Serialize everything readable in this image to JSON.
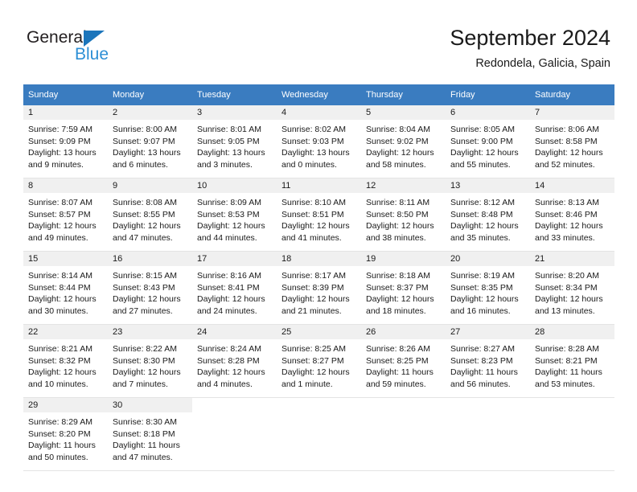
{
  "brand": {
    "name_part1": "General",
    "name_part2": "Blue",
    "logo_icon": "triangle-logo-icon",
    "primary_color": "#1b75bb",
    "secondary_color": "#2d8fd5"
  },
  "header": {
    "title": "September 2024",
    "location": "Redondela, Galicia, Spain"
  },
  "calendar": {
    "header_bg": "#3a7cc0",
    "daynum_bg": "#f0f0f0",
    "weekday_headers": [
      "Sunday",
      "Monday",
      "Tuesday",
      "Wednesday",
      "Thursday",
      "Friday",
      "Saturday"
    ],
    "weeks": [
      [
        {
          "day": "1",
          "sunrise": "Sunrise: 7:59 AM",
          "sunset": "Sunset: 9:09 PM",
          "daylight_line1": "Daylight: 13 hours",
          "daylight_line2": "and 9 minutes."
        },
        {
          "day": "2",
          "sunrise": "Sunrise: 8:00 AM",
          "sunset": "Sunset: 9:07 PM",
          "daylight_line1": "Daylight: 13 hours",
          "daylight_line2": "and 6 minutes."
        },
        {
          "day": "3",
          "sunrise": "Sunrise: 8:01 AM",
          "sunset": "Sunset: 9:05 PM",
          "daylight_line1": "Daylight: 13 hours",
          "daylight_line2": "and 3 minutes."
        },
        {
          "day": "4",
          "sunrise": "Sunrise: 8:02 AM",
          "sunset": "Sunset: 9:03 PM",
          "daylight_line1": "Daylight: 13 hours",
          "daylight_line2": "and 0 minutes."
        },
        {
          "day": "5",
          "sunrise": "Sunrise: 8:04 AM",
          "sunset": "Sunset: 9:02 PM",
          "daylight_line1": "Daylight: 12 hours",
          "daylight_line2": "and 58 minutes."
        },
        {
          "day": "6",
          "sunrise": "Sunrise: 8:05 AM",
          "sunset": "Sunset: 9:00 PM",
          "daylight_line1": "Daylight: 12 hours",
          "daylight_line2": "and 55 minutes."
        },
        {
          "day": "7",
          "sunrise": "Sunrise: 8:06 AM",
          "sunset": "Sunset: 8:58 PM",
          "daylight_line1": "Daylight: 12 hours",
          "daylight_line2": "and 52 minutes."
        }
      ],
      [
        {
          "day": "8",
          "sunrise": "Sunrise: 8:07 AM",
          "sunset": "Sunset: 8:57 PM",
          "daylight_line1": "Daylight: 12 hours",
          "daylight_line2": "and 49 minutes."
        },
        {
          "day": "9",
          "sunrise": "Sunrise: 8:08 AM",
          "sunset": "Sunset: 8:55 PM",
          "daylight_line1": "Daylight: 12 hours",
          "daylight_line2": "and 47 minutes."
        },
        {
          "day": "10",
          "sunrise": "Sunrise: 8:09 AM",
          "sunset": "Sunset: 8:53 PM",
          "daylight_line1": "Daylight: 12 hours",
          "daylight_line2": "and 44 minutes."
        },
        {
          "day": "11",
          "sunrise": "Sunrise: 8:10 AM",
          "sunset": "Sunset: 8:51 PM",
          "daylight_line1": "Daylight: 12 hours",
          "daylight_line2": "and 41 minutes."
        },
        {
          "day": "12",
          "sunrise": "Sunrise: 8:11 AM",
          "sunset": "Sunset: 8:50 PM",
          "daylight_line1": "Daylight: 12 hours",
          "daylight_line2": "and 38 minutes."
        },
        {
          "day": "13",
          "sunrise": "Sunrise: 8:12 AM",
          "sunset": "Sunset: 8:48 PM",
          "daylight_line1": "Daylight: 12 hours",
          "daylight_line2": "and 35 minutes."
        },
        {
          "day": "14",
          "sunrise": "Sunrise: 8:13 AM",
          "sunset": "Sunset: 8:46 PM",
          "daylight_line1": "Daylight: 12 hours",
          "daylight_line2": "and 33 minutes."
        }
      ],
      [
        {
          "day": "15",
          "sunrise": "Sunrise: 8:14 AM",
          "sunset": "Sunset: 8:44 PM",
          "daylight_line1": "Daylight: 12 hours",
          "daylight_line2": "and 30 minutes."
        },
        {
          "day": "16",
          "sunrise": "Sunrise: 8:15 AM",
          "sunset": "Sunset: 8:43 PM",
          "daylight_line1": "Daylight: 12 hours",
          "daylight_line2": "and 27 minutes."
        },
        {
          "day": "17",
          "sunrise": "Sunrise: 8:16 AM",
          "sunset": "Sunset: 8:41 PM",
          "daylight_line1": "Daylight: 12 hours",
          "daylight_line2": "and 24 minutes."
        },
        {
          "day": "18",
          "sunrise": "Sunrise: 8:17 AM",
          "sunset": "Sunset: 8:39 PM",
          "daylight_line1": "Daylight: 12 hours",
          "daylight_line2": "and 21 minutes."
        },
        {
          "day": "19",
          "sunrise": "Sunrise: 8:18 AM",
          "sunset": "Sunset: 8:37 PM",
          "daylight_line1": "Daylight: 12 hours",
          "daylight_line2": "and 18 minutes."
        },
        {
          "day": "20",
          "sunrise": "Sunrise: 8:19 AM",
          "sunset": "Sunset: 8:35 PM",
          "daylight_line1": "Daylight: 12 hours",
          "daylight_line2": "and 16 minutes."
        },
        {
          "day": "21",
          "sunrise": "Sunrise: 8:20 AM",
          "sunset": "Sunset: 8:34 PM",
          "daylight_line1": "Daylight: 12 hours",
          "daylight_line2": "and 13 minutes."
        }
      ],
      [
        {
          "day": "22",
          "sunrise": "Sunrise: 8:21 AM",
          "sunset": "Sunset: 8:32 PM",
          "daylight_line1": "Daylight: 12 hours",
          "daylight_line2": "and 10 minutes."
        },
        {
          "day": "23",
          "sunrise": "Sunrise: 8:22 AM",
          "sunset": "Sunset: 8:30 PM",
          "daylight_line1": "Daylight: 12 hours",
          "daylight_line2": "and 7 minutes."
        },
        {
          "day": "24",
          "sunrise": "Sunrise: 8:24 AM",
          "sunset": "Sunset: 8:28 PM",
          "daylight_line1": "Daylight: 12 hours",
          "daylight_line2": "and 4 minutes."
        },
        {
          "day": "25",
          "sunrise": "Sunrise: 8:25 AM",
          "sunset": "Sunset: 8:27 PM",
          "daylight_line1": "Daylight: 12 hours",
          "daylight_line2": "and 1 minute."
        },
        {
          "day": "26",
          "sunrise": "Sunrise: 8:26 AM",
          "sunset": "Sunset: 8:25 PM",
          "daylight_line1": "Daylight: 11 hours",
          "daylight_line2": "and 59 minutes."
        },
        {
          "day": "27",
          "sunrise": "Sunrise: 8:27 AM",
          "sunset": "Sunset: 8:23 PM",
          "daylight_line1": "Daylight: 11 hours",
          "daylight_line2": "and 56 minutes."
        },
        {
          "day": "28",
          "sunrise": "Sunrise: 8:28 AM",
          "sunset": "Sunset: 8:21 PM",
          "daylight_line1": "Daylight: 11 hours",
          "daylight_line2": "and 53 minutes."
        }
      ],
      [
        {
          "day": "29",
          "sunrise": "Sunrise: 8:29 AM",
          "sunset": "Sunset: 8:20 PM",
          "daylight_line1": "Daylight: 11 hours",
          "daylight_line2": "and 50 minutes."
        },
        {
          "day": "30",
          "sunrise": "Sunrise: 8:30 AM",
          "sunset": "Sunset: 8:18 PM",
          "daylight_line1": "Daylight: 11 hours",
          "daylight_line2": "and 47 minutes."
        },
        {
          "day": "",
          "sunrise": "",
          "sunset": "",
          "daylight_line1": "",
          "daylight_line2": ""
        },
        {
          "day": "",
          "sunrise": "",
          "sunset": "",
          "daylight_line1": "",
          "daylight_line2": ""
        },
        {
          "day": "",
          "sunrise": "",
          "sunset": "",
          "daylight_line1": "",
          "daylight_line2": ""
        },
        {
          "day": "",
          "sunrise": "",
          "sunset": "",
          "daylight_line1": "",
          "daylight_line2": ""
        },
        {
          "day": "",
          "sunrise": "",
          "sunset": "",
          "daylight_line1": "",
          "daylight_line2": ""
        }
      ]
    ]
  }
}
